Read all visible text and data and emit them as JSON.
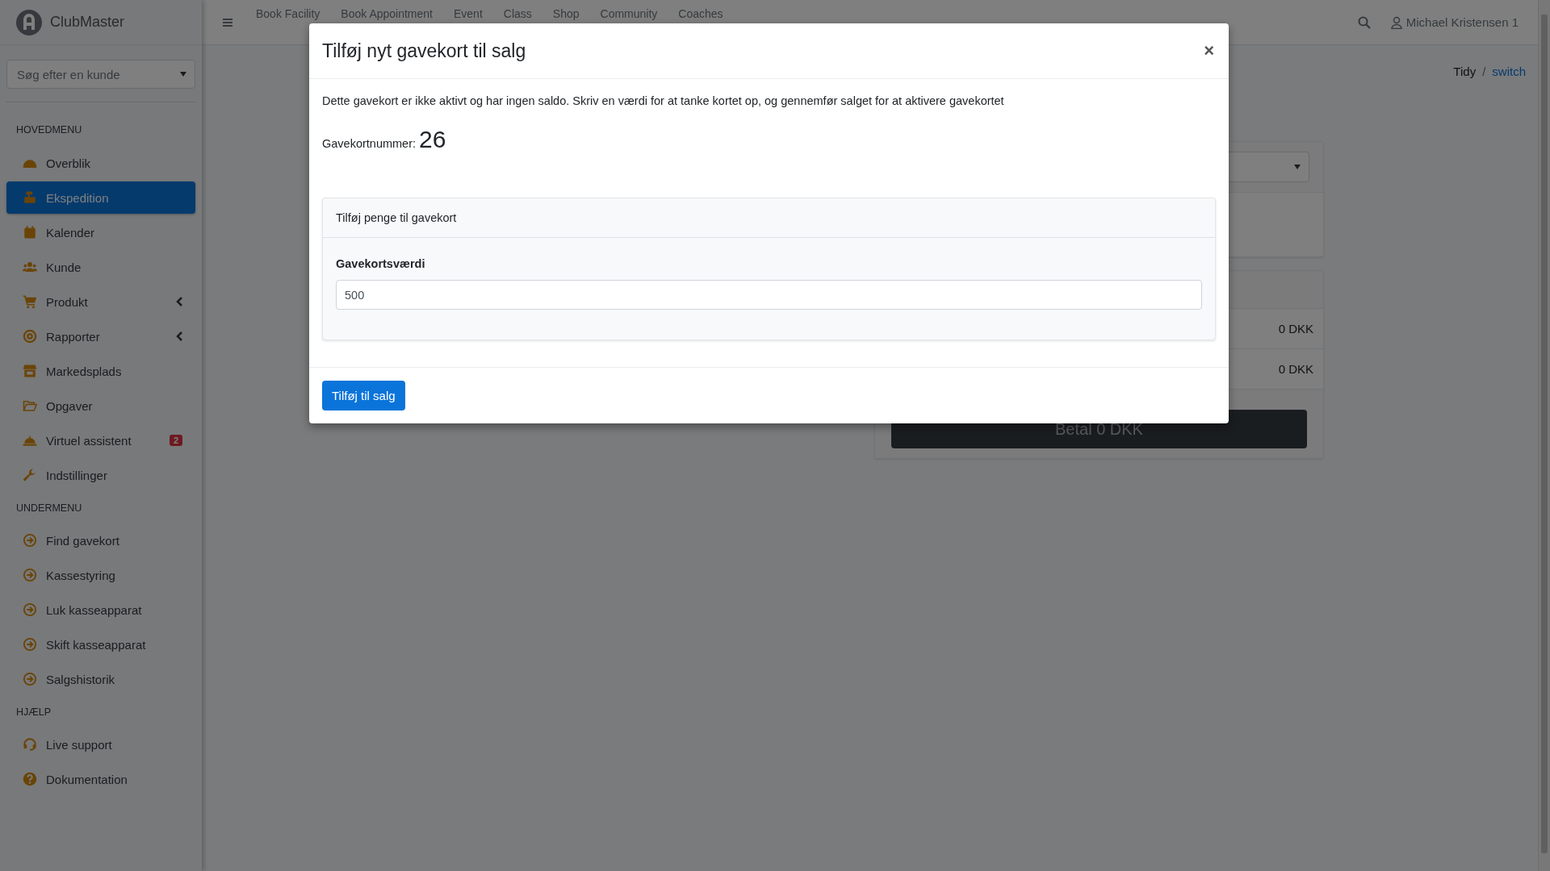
{
  "app": {
    "name": "ClubMaster"
  },
  "topbar": {
    "nav": [
      "Book Facility",
      "Book Appointment",
      "Event",
      "Class",
      "Shop",
      "Community",
      "Coaches"
    ],
    "user": "Michael Kristensen 1"
  },
  "sidebar": {
    "search": {
      "placeholder": "Søg efter en kunde"
    },
    "sections": [
      {
        "title": "HOVEDMENU",
        "items": [
          {
            "label": "Overblik",
            "selected": false,
            "submenu": false
          },
          {
            "label": "Ekspedition",
            "selected": true,
            "submenu": false
          },
          {
            "label": "Kalender",
            "selected": false,
            "submenu": false
          },
          {
            "label": "Kunde",
            "selected": false,
            "submenu": false
          },
          {
            "label": "Produkt",
            "selected": false,
            "submenu": true
          },
          {
            "label": "Rapporter",
            "selected": false,
            "submenu": true
          },
          {
            "label": "Markedsplads",
            "selected": false,
            "submenu": false
          },
          {
            "label": "Opgaver",
            "selected": false,
            "submenu": false
          },
          {
            "label": "Virtuel assistent",
            "selected": false,
            "submenu": false,
            "badge": "2"
          },
          {
            "label": "Indstillinger",
            "selected": false,
            "submenu": false
          }
        ]
      },
      {
        "title": "UNDERMENU",
        "items": [
          {
            "label": "Find gavekort",
            "selected": false,
            "submenu": false
          },
          {
            "label": "Kassestyring",
            "selected": false,
            "submenu": false
          },
          {
            "label": "Luk kasseapparat",
            "selected": false,
            "submenu": false
          },
          {
            "label": "Skift kasseapparat",
            "selected": false,
            "submenu": false
          },
          {
            "label": "Salgshistorik",
            "selected": false,
            "submenu": false
          }
        ]
      },
      {
        "title": "HJÆLP",
        "items": [
          {
            "label": "Live support",
            "selected": false,
            "submenu": false
          },
          {
            "label": "Dokumentation",
            "selected": false,
            "submenu": false
          }
        ]
      }
    ]
  },
  "breadcrumb": {
    "items": [
      "Tidy",
      "switch"
    ],
    "separator": "/"
  },
  "sale_panel": {
    "rows": [
      "0 DKK",
      "0 DKK"
    ],
    "pay_button": "Betal 0 DKK"
  },
  "modal": {
    "title": "Tilføj nyt gavekort til salg",
    "close": "×",
    "description": "Dette gavekort er ikke aktivt og har ingen saldo. Skriv en værdi for at tanke kortet op, og gennemfør salget for at aktivere gavekortet",
    "number_label": "Gavekortnummer:",
    "number": "26",
    "card": {
      "title": "Tilføj penge til gavekort",
      "field_label": "Gavekortsværdi",
      "value": "500"
    },
    "submit": "Tilføj til salg"
  }
}
